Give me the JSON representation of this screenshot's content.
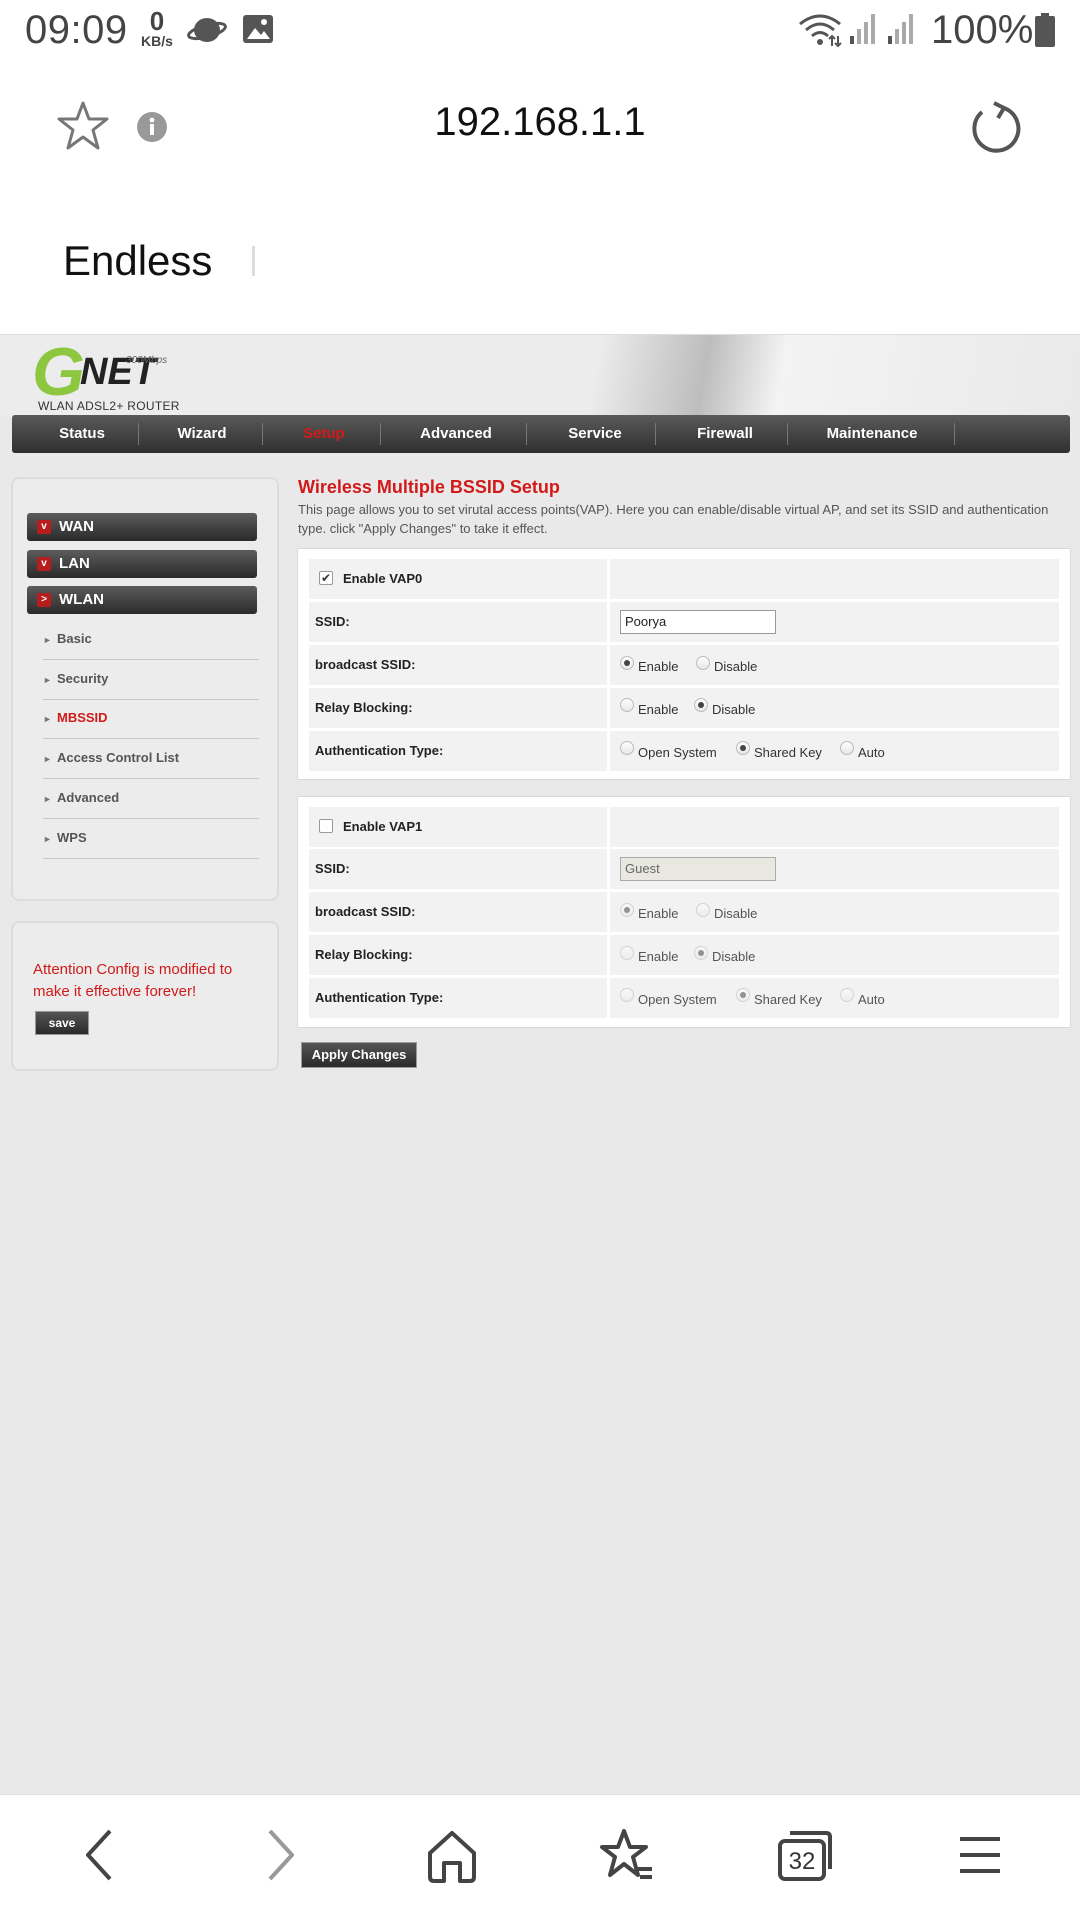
{
  "status_bar": {
    "time": "09:09",
    "net_speed_value": "0",
    "net_speed_unit": "KB/s",
    "battery_text": "100%",
    "icons": [
      "planet-icon",
      "gallery-icon",
      "wifi-icon",
      "signal-icon",
      "signal-icon",
      "battery-icon"
    ]
  },
  "browser": {
    "url": "192.168.1.1",
    "page_title": "Endless"
  },
  "router": {
    "logo": {
      "brand_g": "G",
      "brand_net": "NET",
      "speed": "300Mbps",
      "subtitle": "WLAN ADSL2+ ROUTER"
    },
    "nav": [
      "Status",
      "Wizard",
      "Setup",
      "Advanced",
      "Service",
      "Firewall",
      "Maintenance"
    ],
    "active_nav": "Setup",
    "sidebar": {
      "sections": [
        "WAN",
        "LAN",
        "WLAN"
      ],
      "items": [
        "Basic",
        "Security",
        "MBSSID",
        "Access Control List",
        "Advanced",
        "WPS"
      ],
      "active_item": "MBSSID"
    },
    "attention": {
      "text": "Attention Config is modified to make it effective forever!",
      "save_label": "save"
    },
    "content": {
      "title": "Wireless Multiple BSSID Setup",
      "description": "This page allows you to set virutal access points(VAP). Here you can enable/disable virtual AP, and set its SSID and authentication type. click \"Apply Changes\" to take it effect."
    },
    "vaps": [
      {
        "enable_label": "Enable VAP0",
        "enabled": true,
        "ssid_label": "SSID:",
        "ssid_value": "Poorya",
        "broadcast_label": "broadcast SSID:",
        "broadcast_options": [
          "Enable",
          "Disable"
        ],
        "broadcast_selected": "Enable",
        "relay_label": "Relay Blocking:",
        "relay_options": [
          "Enable",
          "Disable"
        ],
        "relay_selected": "Disable",
        "auth_label": "Authentication Type:",
        "auth_options": [
          "Open System",
          "Shared Key",
          "Auto"
        ],
        "auth_selected": "Shared Key"
      },
      {
        "enable_label": "Enable VAP1",
        "enabled": false,
        "ssid_label": "SSID:",
        "ssid_value": "Guest",
        "broadcast_label": "broadcast SSID:",
        "broadcast_options": [
          "Enable",
          "Disable"
        ],
        "broadcast_selected": "Enable",
        "relay_label": "Relay Blocking:",
        "relay_options": [
          "Enable",
          "Disable"
        ],
        "relay_selected": "Disable",
        "auth_label": "Authentication Type:",
        "auth_options": [
          "Open System",
          "Shared Key",
          "Auto"
        ],
        "auth_selected": "Shared Key"
      }
    ],
    "apply_label": "Apply Changes"
  },
  "bottom_nav": {
    "tabs_count": "32",
    "icons": [
      "back-icon",
      "forward-icon",
      "home-icon",
      "bookmarks-icon",
      "tabs-icon",
      "menu-icon"
    ]
  }
}
